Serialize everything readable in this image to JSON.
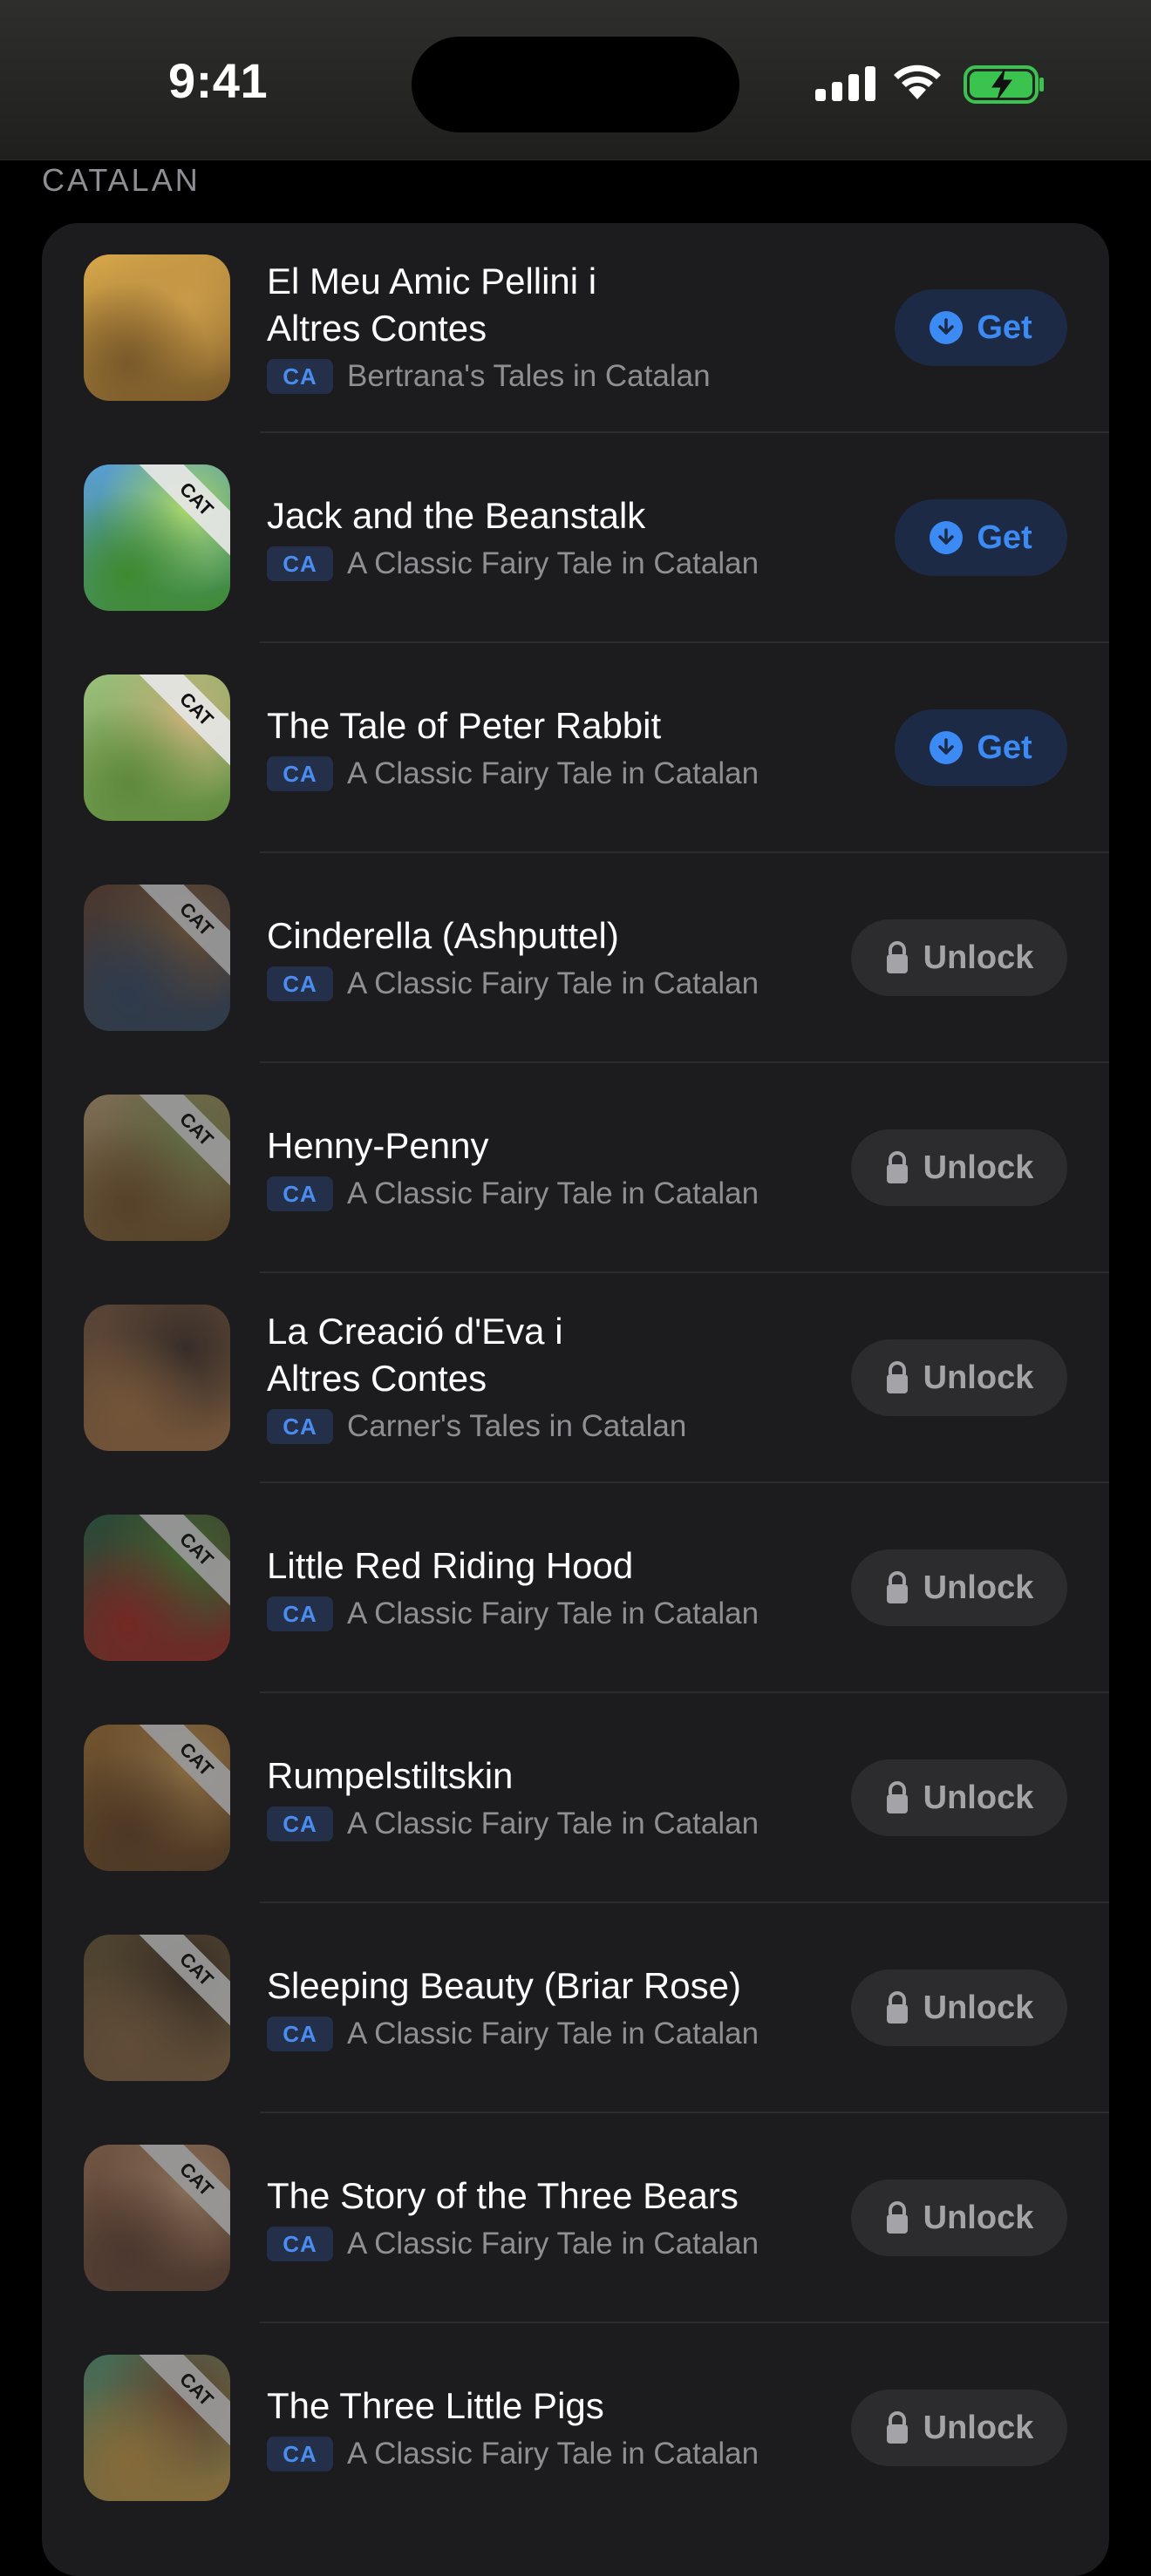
{
  "status_bar": {
    "time": "9:41"
  },
  "section": {
    "title": "CATALAN"
  },
  "books": [
    {
      "title_lines": [
        "El Meu Amic Pellini i",
        "Altres Contes"
      ],
      "lang": "CA",
      "subtitle": "Bertrana's Tales in Catalan",
      "action": "Get",
      "ribbon": "",
      "colors": [
        "#d8a84a",
        "#7a5a2a",
        "#c99a48"
      ]
    },
    {
      "title_lines": [
        "Jack and the Beanstalk"
      ],
      "lang": "CA",
      "subtitle": "A Classic Fairy Tale in Catalan",
      "action": "Get",
      "ribbon": "CAT",
      "colors": [
        "#5a9fd8",
        "#3f8a2f",
        "#a9d66a"
      ]
    },
    {
      "title_lines": [
        "The Tale of Peter Rabbit"
      ],
      "lang": "CA",
      "subtitle": "A Classic Fairy Tale in Catalan",
      "action": "Get",
      "ribbon": "CAT",
      "colors": [
        "#9cc07c",
        "#5f8a3c",
        "#c7b07a"
      ]
    },
    {
      "title_lines": [
        "Cinderella (Ashputtel)"
      ],
      "lang": "CA",
      "subtitle": "A Classic Fairy Tale in Catalan",
      "action": "Unlock",
      "ribbon": "CAT",
      "colors": [
        "#6a4a38",
        "#3a4f6a",
        "#8a6a48"
      ]
    },
    {
      "title_lines": [
        "Henny-Penny"
      ],
      "lang": "CA",
      "subtitle": "A Classic Fairy Tale in Catalan",
      "action": "Unlock",
      "ribbon": "CAT",
      "colors": [
        "#b8a078",
        "#7a5a30",
        "#8a9a5a"
      ]
    },
    {
      "title_lines": [
        "La Creació d'Eva i",
        "Altres Contes"
      ],
      "lang": "CA",
      "subtitle": "Carner's Tales in Catalan",
      "action": "Unlock",
      "ribbon": "",
      "colors": [
        "#7a5a44",
        "#a8784a",
        "#4a3a30"
      ]
    },
    {
      "title_lines": [
        "Little Red Riding Hood"
      ],
      "lang": "CA",
      "subtitle": "A Classic Fairy Tale in Catalan",
      "action": "Unlock",
      "ribbon": "CAT",
      "colors": [
        "#2f6a4a",
        "#a83228",
        "#5a8a3a"
      ]
    },
    {
      "title_lines": [
        "Rumpelstiltskin"
      ],
      "lang": "CA",
      "subtitle": "A Classic Fairy Tale in Catalan",
      "action": "Unlock",
      "ribbon": "CAT",
      "colors": [
        "#a8783a",
        "#6a4a2a",
        "#c89a5a"
      ]
    },
    {
      "title_lines": [
        "Sleeping Beauty (Briar Rose)"
      ],
      "lang": "CA",
      "subtitle": "A Classic Fairy Tale in Catalan",
      "action": "Unlock",
      "ribbon": "CAT",
      "colors": [
        "#6a5a3a",
        "#8a6a48",
        "#4a3a2a"
      ]
    },
    {
      "title_lines": [
        "The Story of the Three Bears"
      ],
      "lang": "CA",
      "subtitle": "A Classic Fairy Tale in Catalan",
      "action": "Unlock",
      "ribbon": "CAT",
      "colors": [
        "#a87a5a",
        "#6a4a3a",
        "#c8a07a"
      ]
    },
    {
      "title_lines": [
        "The Three Little Pigs"
      ],
      "lang": "CA",
      "subtitle": "A Classic Fairy Tale in Catalan",
      "action": "Unlock",
      "ribbon": "CAT",
      "colors": [
        "#5a9a7a",
        "#c89a4a",
        "#8a5a3a"
      ]
    }
  ],
  "colors": {
    "accent": "#3c8bf5",
    "card": "#1c1c1e",
    "secondary_text": "#8e8e93"
  }
}
